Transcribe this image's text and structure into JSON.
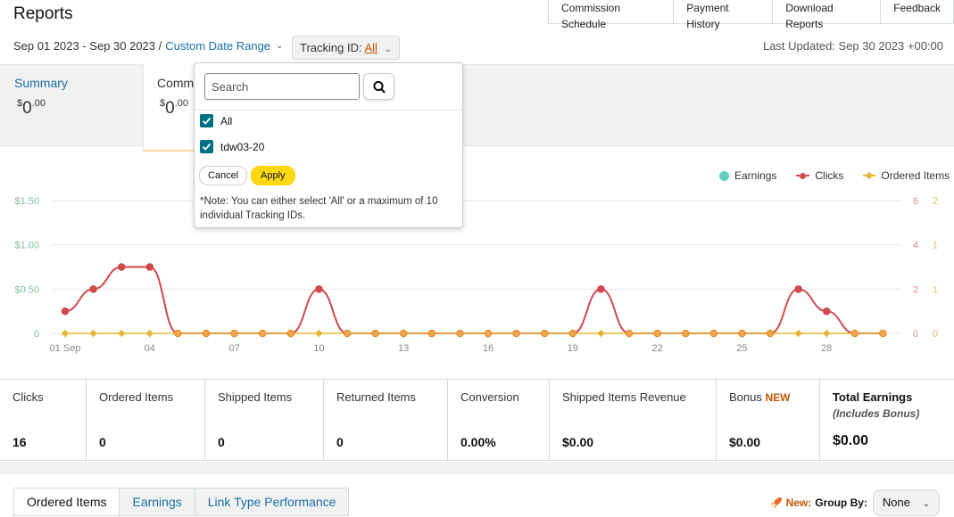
{
  "header": {
    "title": "Reports",
    "tabs": [
      "Commission Schedule",
      "Payment History",
      "Download Reports",
      "Feedback"
    ],
    "date_range": "Sep 01 2023 - Sep 30 2023 /",
    "custom_range_label": "Custom Date Range",
    "tracking_label": "Tracking ID:",
    "tracking_value": "All",
    "last_updated": "Last Updated: Sep 30 2023 +00:00"
  },
  "summary": {
    "active_label": "Summary",
    "active_currency": "$",
    "active_whole": "0",
    "active_cents": ".00",
    "second_label": "Comm",
    "second_currency": "$",
    "second_whole": "0",
    "second_cents": ".00"
  },
  "dropdown": {
    "search_placeholder": "Search",
    "options": [
      {
        "label": "All",
        "checked": true
      },
      {
        "label": "tdw03-20",
        "checked": true
      }
    ],
    "cancel_label": "Cancel",
    "apply_label": "Apply",
    "note": "*Note: You can either select 'All' or a maximum of 10 individual Tracking IDs."
  },
  "chart_data": {
    "type": "line",
    "x": [
      "01 Sep",
      "02",
      "03",
      "04",
      "05",
      "06",
      "07",
      "08",
      "09",
      "10",
      "11",
      "12",
      "13",
      "14",
      "15",
      "16",
      "17",
      "18",
      "19",
      "20",
      "21",
      "22",
      "23",
      "24",
      "25",
      "26",
      "27",
      "28",
      "29",
      "30"
    ],
    "x_tick_labels": {
      "0": "01 Sep",
      "3": "04",
      "6": "07",
      "9": "10",
      "12": "13",
      "15": "16",
      "18": "19",
      "21": "22",
      "24": "25",
      "27": "28"
    },
    "series": [
      {
        "name": "Earnings",
        "color": "#5fd3bd",
        "axis": "left",
        "values": [
          0,
          0,
          0,
          0,
          0,
          0,
          0,
          0,
          0,
          0,
          0,
          0,
          0,
          0,
          0,
          0,
          0,
          0,
          0,
          0,
          0,
          0,
          0,
          0,
          0,
          0,
          0,
          0,
          0,
          0
        ]
      },
      {
        "name": "Clicks",
        "color": "#d0494f",
        "axis": "right1",
        "values": [
          1,
          2,
          3,
          3,
          0,
          0,
          0,
          0,
          0,
          2,
          0,
          0,
          0,
          0,
          0,
          0,
          0,
          0,
          0,
          2,
          0,
          0,
          0,
          0,
          0,
          0,
          2,
          1,
          0,
          0
        ]
      },
      {
        "name": "Ordered Items",
        "color": "#e5b936",
        "axis": "right2",
        "values": [
          0,
          0,
          0,
          0,
          0,
          0,
          0,
          0,
          0,
          0,
          0,
          0,
          0,
          0,
          0,
          0,
          0,
          0,
          0,
          0,
          0,
          0,
          0,
          0,
          0,
          0,
          0,
          0,
          0,
          0
        ]
      }
    ],
    "y_left_ticks": [
      "0",
      "$0.50",
      "$1.00",
      "$1.50"
    ],
    "y_left_lim": [
      0,
      1.5
    ],
    "y_right1_ticks": [
      "0",
      "2",
      "4",
      "6"
    ],
    "y_right1_lim": [
      0,
      6
    ],
    "y_right2_ticks": [
      "0",
      "1",
      "1",
      "2"
    ],
    "grid": true,
    "legend_position": "top-right"
  },
  "metrics": [
    {
      "label": "Clicks",
      "value": "16"
    },
    {
      "label": "Ordered Items",
      "value": "0"
    },
    {
      "label": "Shipped Items",
      "value": "0"
    },
    {
      "label": "Returned Items",
      "value": "0"
    },
    {
      "label": "Conversion",
      "value": "0.00%"
    },
    {
      "label": "Shipped Items Revenue",
      "value": "$0.00"
    },
    {
      "label": "Bonus",
      "badge": "NEW",
      "value": "$0.00"
    },
    {
      "label": "Total Earnings",
      "sublabel": "(Includes Bonus)",
      "value": "$0.00"
    }
  ],
  "bottom_tabs": [
    "Ordered Items",
    "Earnings",
    "Link Type Performance"
  ],
  "group_by": {
    "new_label": "New:",
    "label": "Group By:",
    "value": "None"
  },
  "colors": {
    "link": "#1d6fa5",
    "accent": "#c45500",
    "checkbox": "#007185",
    "apply": "#ffd814"
  }
}
